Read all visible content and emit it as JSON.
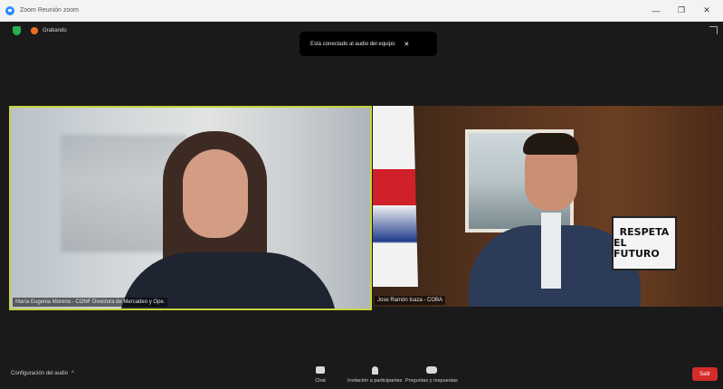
{
  "window": {
    "title": "Zoom Reunión zoom",
    "minimize_glyph": "—",
    "maximize_glyph": "❐",
    "close_glyph": "✕"
  },
  "top_bar": {
    "recording_label": "Grabando",
    "toast_text": "Está conectado al audio del equipo",
    "toast_close_glyph": "✕"
  },
  "participants": [
    {
      "name_label": "María Eugenia Moreno - CONF Directora de Mercadeo y Ope.",
      "active_speaker": true
    },
    {
      "name_label": "Jose Ramón Icaza - COBA",
      "sign_lines": [
        "RESPETA",
        "EL FUTURO"
      ]
    }
  ],
  "toolbar": {
    "audio_settings_label": "Configuración del audio",
    "audio_caret": "^",
    "buttons": [
      {
        "label": "Chat",
        "icon": "chat-icon"
      },
      {
        "label": "Invitación a participantes",
        "icon": "invite-icon"
      },
      {
        "label": "Preguntas y respuestas",
        "icon": "reactions-icon"
      }
    ],
    "leave_label": "Salir"
  },
  "colors": {
    "active_speaker_border": "#c8d33a",
    "leave_red": "#d52b2b",
    "recording_orange": "#f26d21",
    "security_green": "#23b14d"
  }
}
